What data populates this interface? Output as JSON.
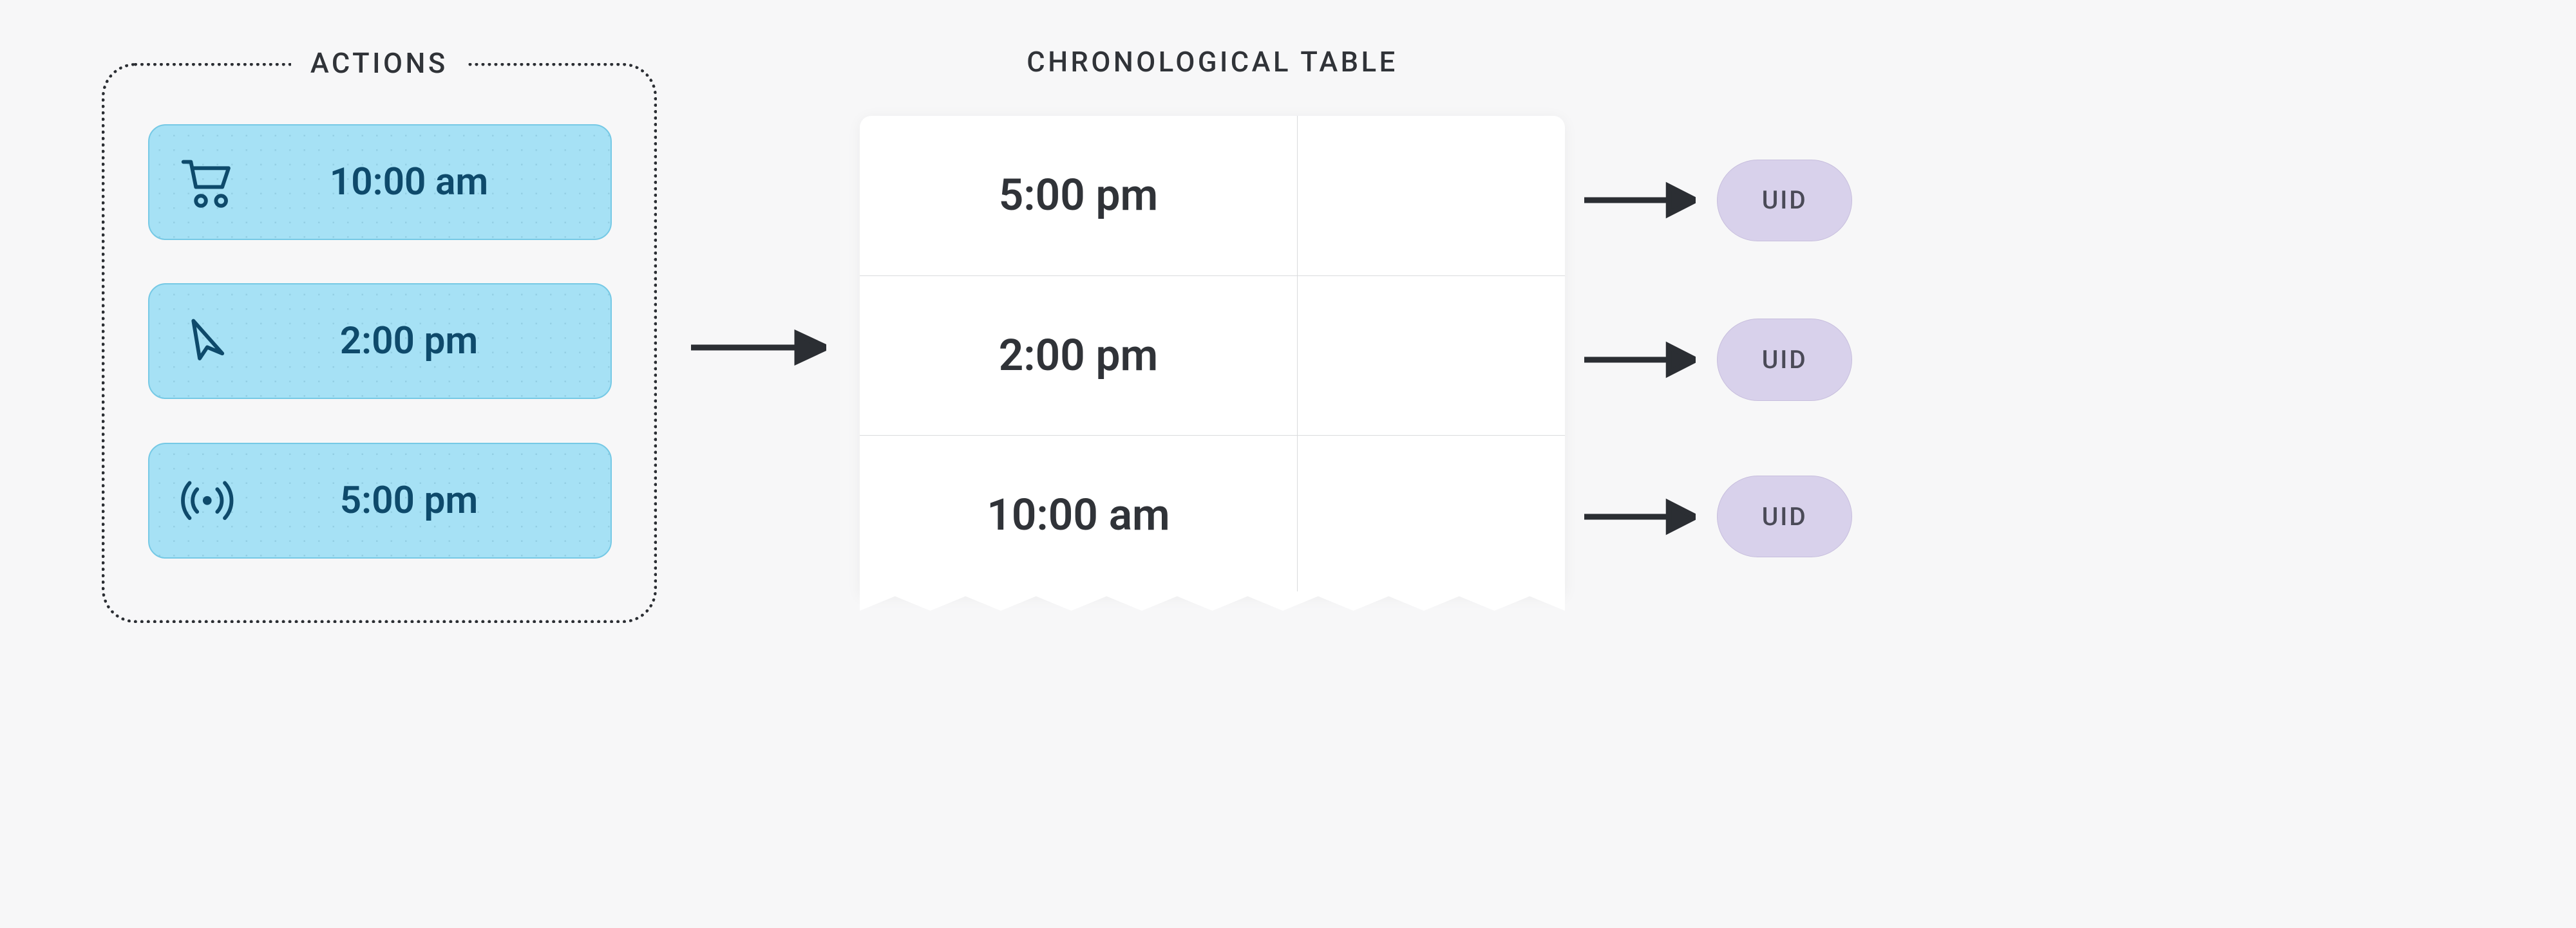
{
  "actions": {
    "heading": "ACTIONS",
    "items": [
      {
        "icon": "cart-icon",
        "time": "10:00 am"
      },
      {
        "icon": "cursor-icon",
        "time": "2:00 pm"
      },
      {
        "icon": "signal-icon",
        "time": "5:00 pm"
      }
    ]
  },
  "chrono": {
    "heading": "CHRONOLOGICAL TABLE",
    "rows": [
      {
        "time": "5:00 pm"
      },
      {
        "time": "2:00 pm"
      },
      {
        "time": "10:00 am"
      }
    ]
  },
  "uids": [
    {
      "label": "UID"
    },
    {
      "label": "UID"
    },
    {
      "label": "UID"
    }
  ],
  "colors": {
    "action_card_bg": "#a6e1f5",
    "action_card_text": "#0e4a6b",
    "uid_bg": "#d8d1eb",
    "page_bg": "#f7f7f8"
  }
}
